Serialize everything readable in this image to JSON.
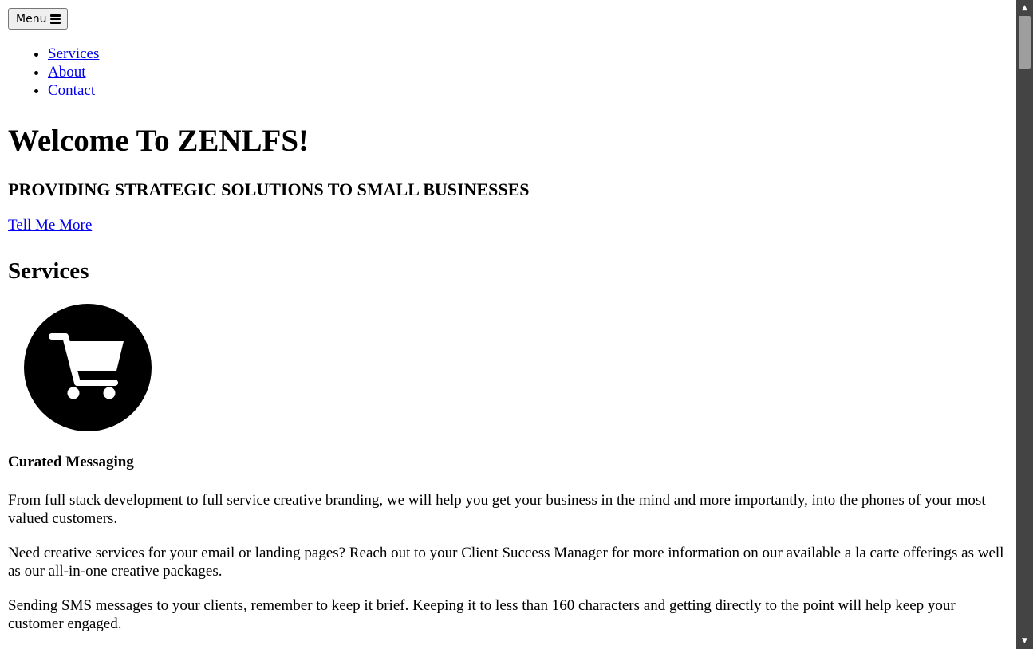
{
  "menu_button": {
    "label": "Menu",
    "icon": "hamburger-icon"
  },
  "nav": {
    "items": [
      {
        "label": "Services"
      },
      {
        "label": "About"
      },
      {
        "label": "Contact"
      }
    ]
  },
  "hero": {
    "title": "Welcome To ZENLFS!",
    "tagline": "PROVIDING STRATEGIC SOLUTIONS TO SMALL BUSINESSES",
    "cta": "Tell Me More"
  },
  "services": {
    "heading": "Services",
    "item": {
      "icon": "shopping-cart-icon",
      "title": "Curated Messaging",
      "paragraphs": [
        "From full stack development to full service creative branding, we will help you get your business in the mind and more importantly, into the phones of your most valued customers.",
        "Need creative services for your email or landing pages? Reach out to your Client Success Manager for more information on our available a la carte offerings as well as our all-in-one creative packages.",
        "Sending SMS messages to your clients, remember to keep it brief. Keeping it to less than 160 characters and getting directly to the point will help keep your customer engaged."
      ]
    }
  },
  "colors": {
    "link": "#0000ee",
    "scrollbar_track": "#444444",
    "scrollbar_thumb": "#9e9e9e"
  }
}
